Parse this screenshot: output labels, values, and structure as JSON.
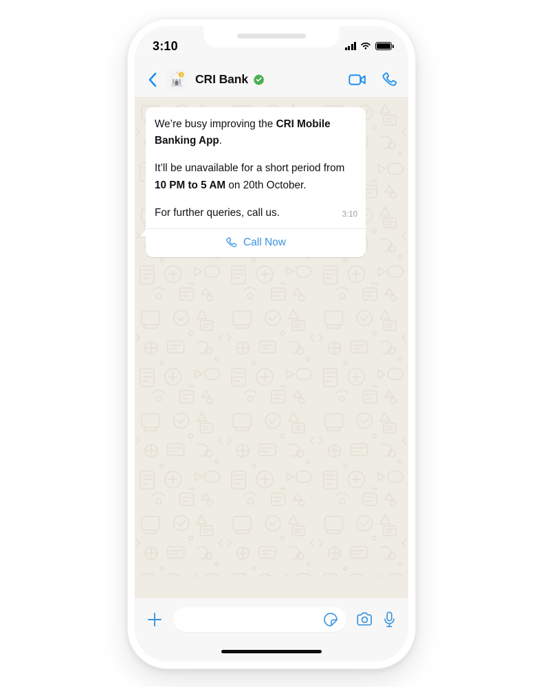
{
  "status_bar": {
    "time": "3:10",
    "icons": {
      "signal": "signal-bars-icon",
      "wifi": "wifi-icon",
      "battery": "battery-icon"
    }
  },
  "chat_header": {
    "back_icon": "back-chevron-icon",
    "avatar_icon": "bank-building-avatar",
    "contact_name": "CRI Bank",
    "verified_icon": "verified-badge-icon",
    "video_call_icon": "video-camera-icon",
    "voice_call_icon": "phone-handset-icon"
  },
  "message": {
    "line1_prefix": "We’re busy improving the ",
    "line1_bold": "CRI Mobile Banking App",
    "line1_suffix": ".",
    "line2_prefix": "It’ll be unavailable for a short period from ",
    "line2_bold": "10 PM to 5 AM",
    "line2_suffix": " on 20th October.",
    "line3": "For further queries, call us.",
    "timestamp": "3:10",
    "call_action_label": "Call Now",
    "call_action_icon": "phone-handset-icon"
  },
  "input_bar": {
    "plus_icon": "plus-icon",
    "input_value": "",
    "input_placeholder": "",
    "sticker_icon": "sticker-icon",
    "camera_icon": "camera-icon",
    "mic_icon": "microphone-icon"
  },
  "colors": {
    "accent_blue": "#3a93e0",
    "verified_green": "#4CAF50",
    "chat_background": "#efece4",
    "header_background": "#f7f7f7",
    "bubble_background": "#ffffff"
  }
}
